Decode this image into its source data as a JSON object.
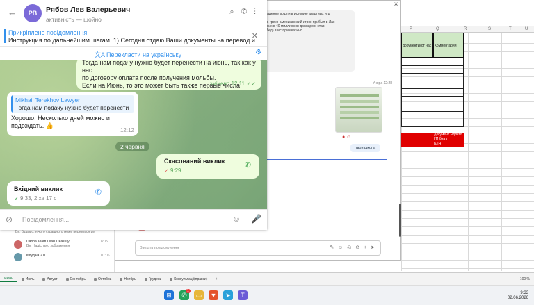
{
  "telegram": {
    "avatar_initials": "РВ",
    "contact_name": "Рябов Лев Валерьевич",
    "status": "активність — щойно",
    "pinned_title": "Прикріплене повідомлення",
    "pinned_text": "Инструкция по дальнейшим шагам.  1) Сегодня отдаю Ваши документы на перевод и ...",
    "translate_label": "Перекласти на українську",
    "input_placeholder": "Повідомлення...",
    "date_divider": "2 червня",
    "messages": [
      {
        "lines": [
          "Тогда нам подачу нужно будет перенести на июнь, так как у нас",
          "по договору оплата после получения мольбы.",
          "Если на Июнь, то это может быть также первые числа июня"
        ],
        "meta": "змінено 12:11"
      },
      {
        "quote_author": "Mikhail Terekhov Lawyer",
        "quote_text": "Тогда нам подачу нужно будет перенести ...",
        "text": "Хорошо. Несколько дней можно и подождать.",
        "time": "12:12"
      },
      {
        "title": "Скасований виклик",
        "sub": "9:29"
      },
      {
        "title": "Вхідний виклик",
        "sub": "9:33, 2 хв 17 с"
      }
    ]
  },
  "middle": {
    "bubble_lines": [
      "ет и падение вошли в историю азартных игр",
      "",
      "ллиов, греко-американский игрок прибыл в Лас-",
      "ыграл их в 40 миллионов долларов, став",
      "ой побед) в истории казино"
    ],
    "time": "Учора 12:28",
    "reply_label": "твоя школа",
    "input_placeholder": "Введіть повідомлення"
  },
  "left_list": [
    {
      "name": "",
      "sub": "Ви: Будьмо, нічого страшного може вернеться це",
      "time": ""
    },
    {
      "name": "Darina Team Lead Treasury",
      "sub": "Ви: Надіслано зображення",
      "time": "8:05"
    },
    {
      "name": "Флудіна 2.0",
      "sub": "",
      "time": "01:06"
    }
  ],
  "excel": {
    "columns": [
      "P",
      "Q",
      "R",
      "S",
      "T",
      "U"
    ],
    "header_1": "документы(от нас)",
    "header_2": "Комментарии",
    "red_notes": [
      "Документ ыдлчто",
      "ГП бнаъ",
      "БЛЯ"
    ],
    "tabs": [
      "Июнь",
      "Июль",
      "Август",
      "Сентябрь",
      "Октябрь",
      "Ноябрь",
      "Грудень",
      "Консультації(правки)"
    ],
    "zoom": "100 %"
  },
  "taskbar": {
    "time": "9:33",
    "date": "02.06.2026",
    "badge": "1"
  }
}
